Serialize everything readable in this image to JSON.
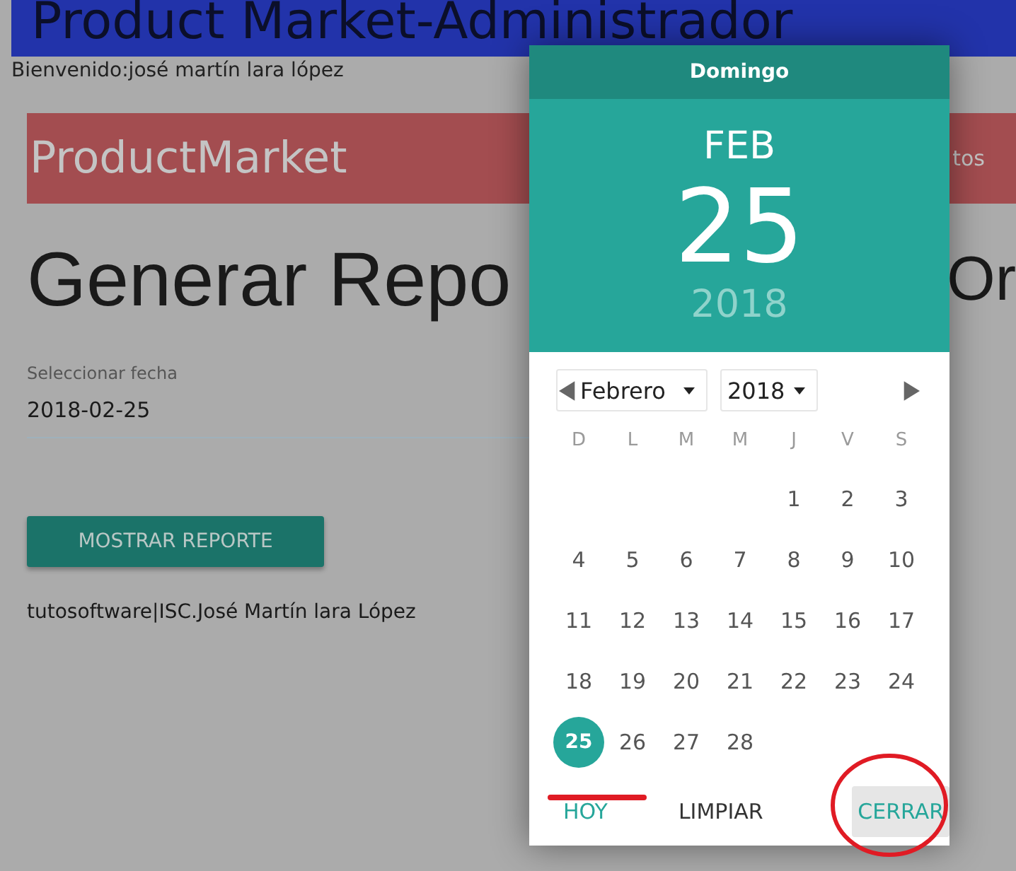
{
  "site_title": "Product Market-Administrador",
  "welcome": "Bienvenido:josé martín lara lópez",
  "navbar": {
    "brand": "ProductMarket",
    "link_fragment": "tos"
  },
  "heading": {
    "left_part": "Generar Repo",
    "right_part": "Or"
  },
  "date_field": {
    "label": "Seleccionar fecha",
    "value": "2018-02-25"
  },
  "show_button": "MOSTRAR REPORTE",
  "footer": "tutosoftware|ISC.José Martín lara López",
  "datepicker": {
    "weekday": "Domingo",
    "month": "FEB",
    "day": "25",
    "year": "2018",
    "month_select": "Febrero",
    "year_select": "2018",
    "weekday_heads": [
      "D",
      "L",
      "M",
      "M",
      "J",
      "V",
      "S"
    ],
    "weeks": [
      {
        "days": [
          {
            "label": "1",
            "selected": false
          },
          {
            "label": "2",
            "selected": false
          },
          {
            "label": "3",
            "selected": false
          }
        ]
      },
      {
        "days": [
          {
            "label": "4",
            "selected": false
          },
          {
            "label": "5",
            "selected": false
          },
          {
            "label": "6",
            "selected": false
          },
          {
            "label": "7",
            "selected": false
          },
          {
            "label": "8",
            "selected": false
          },
          {
            "label": "9",
            "selected": false
          },
          {
            "label": "10",
            "selected": false
          }
        ]
      },
      {
        "days": [
          {
            "label": "11",
            "selected": false
          },
          {
            "label": "12",
            "selected": false
          },
          {
            "label": "13",
            "selected": false
          },
          {
            "label": "14",
            "selected": false
          },
          {
            "label": "15",
            "selected": false
          },
          {
            "label": "16",
            "selected": false
          },
          {
            "label": "17",
            "selected": false
          }
        ]
      },
      {
        "days": [
          {
            "label": "18",
            "selected": false
          },
          {
            "label": "19",
            "selected": false
          },
          {
            "label": "20",
            "selected": false
          },
          {
            "label": "21",
            "selected": false
          },
          {
            "label": "22",
            "selected": false
          },
          {
            "label": "23",
            "selected": false
          },
          {
            "label": "24",
            "selected": false
          }
        ]
      },
      {
        "days": [
          {
            "label": "25",
            "selected": true
          },
          {
            "label": "26",
            "selected": false
          },
          {
            "label": "27",
            "selected": false
          },
          {
            "label": "28",
            "selected": false
          }
        ]
      }
    ],
    "buttons": [
      {
        "label": "HOY",
        "kind": "today"
      },
      {
        "label": "LIMPIAR",
        "kind": "clear"
      },
      {
        "label": "CERRAR",
        "kind": "close"
      }
    ]
  }
}
